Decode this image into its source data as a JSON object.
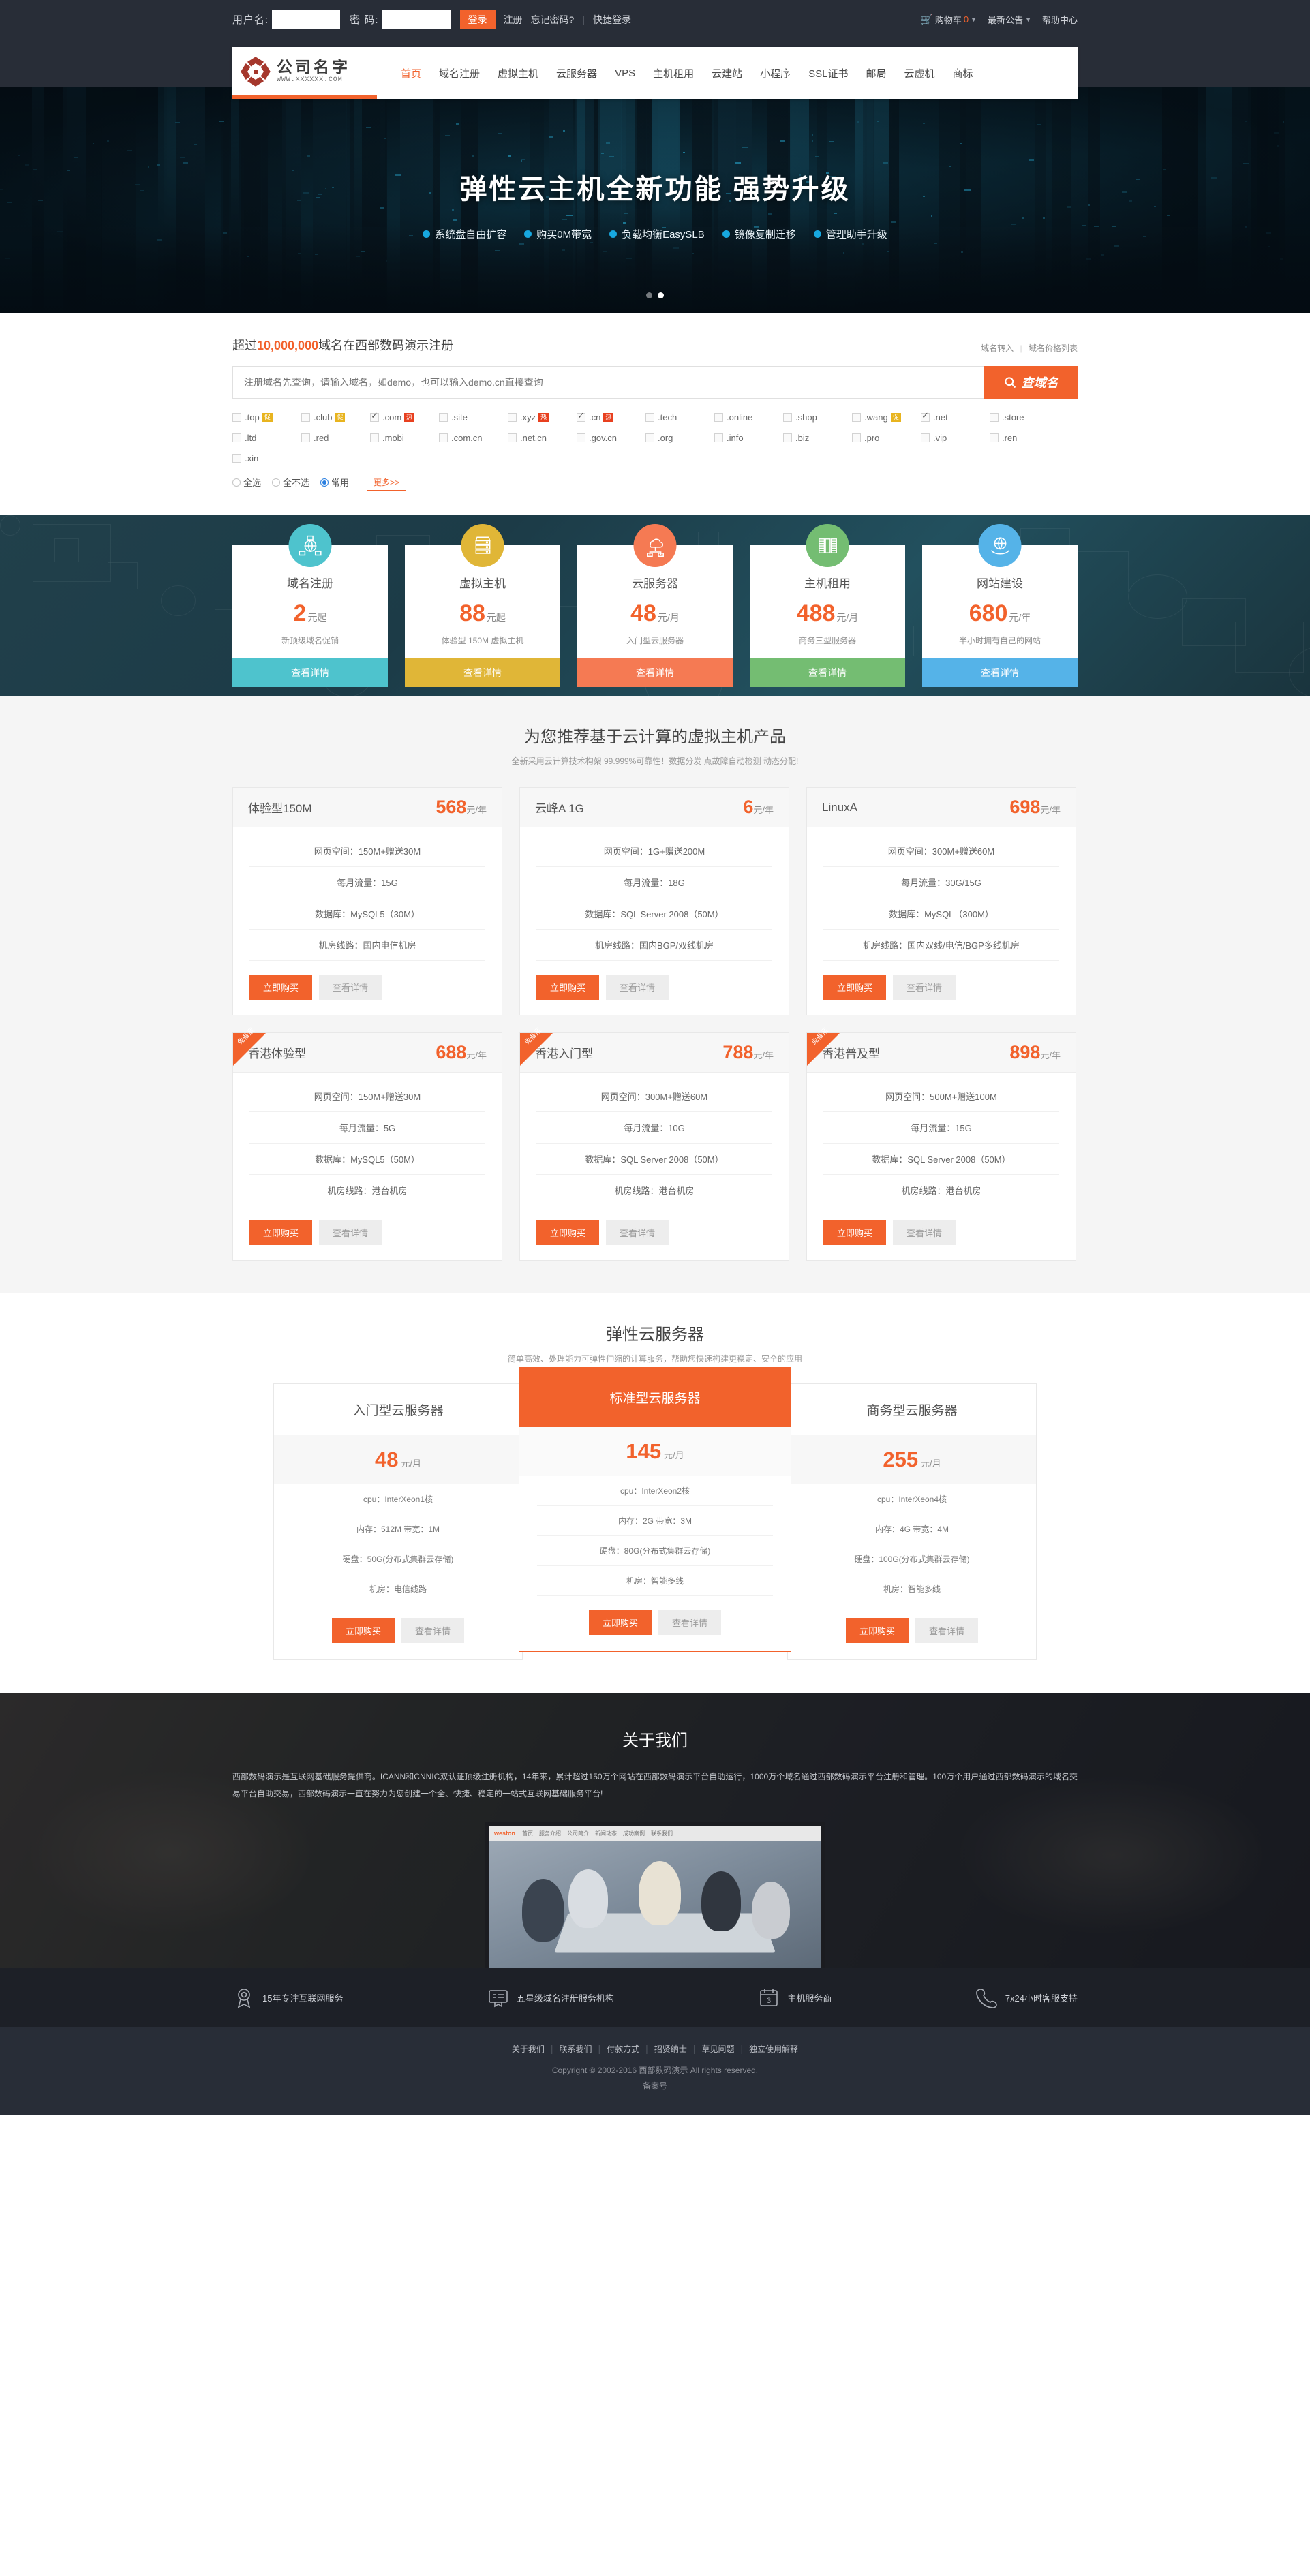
{
  "topbar": {
    "username_label": "用户名:",
    "username_value": "",
    "username_placeholder": "",
    "password_label": "密  码:",
    "password_value": "",
    "password_placeholder": "",
    "login_button": "登录",
    "register_link": "注册",
    "forgot_link": "忘记密码?",
    "quick_login": "快捷登录",
    "cart_label": "购物车",
    "cart_count": "0",
    "notice_label": "最新公告",
    "help_label": "帮助中心"
  },
  "header": {
    "logo_name": "公司名字",
    "logo_url": "WWW.XXXXXX.COM",
    "nav": [
      {
        "label": "首页",
        "active": true
      },
      {
        "label": "域名注册",
        "active": false
      },
      {
        "label": "虚拟主机",
        "active": false
      },
      {
        "label": "云服务器",
        "active": false
      },
      {
        "label": "VPS",
        "active": false
      },
      {
        "label": "主机租用",
        "active": false
      },
      {
        "label": "云建站",
        "active": false
      },
      {
        "label": "小程序",
        "active": false
      },
      {
        "label": "SSL证书",
        "active": false
      },
      {
        "label": "邮局",
        "active": false
      },
      {
        "label": "云虚机",
        "active": false
      },
      {
        "label": "商标",
        "active": false
      }
    ]
  },
  "hero": {
    "title": "弹性云主机全新功能  强势升级",
    "features": [
      "系统盘自由扩容",
      "购买0M带宽",
      "负载均衡EasySLB",
      "镜像复制迁移",
      "管理助手升级"
    ],
    "slides": 2,
    "active_slide": 1
  },
  "domain": {
    "title_pre": "超过",
    "title_num": "10,000,000",
    "title_post": "域名在西部数码演示注册",
    "link_transfer": "域名转入",
    "link_pricelist": "域名价格列表",
    "search_placeholder": "注册域名先查询，请输入域名，如demo，也可以输入demo.cn直接查询",
    "search_value": "",
    "search_button": "查域名",
    "tlds_row1": [
      {
        "name": ".top",
        "checked": false,
        "tag": "促",
        "tagtype": "cu"
      },
      {
        "name": ".club",
        "checked": false,
        "tag": "促",
        "tagtype": "cu"
      },
      {
        "name": ".com",
        "checked": true,
        "tag": "热",
        "tagtype": "hot"
      },
      {
        "name": ".site",
        "checked": false,
        "tag": "",
        "tagtype": ""
      },
      {
        "name": ".xyz",
        "checked": false,
        "tag": "热",
        "tagtype": "hot"
      },
      {
        "name": ".cn",
        "checked": true,
        "tag": "热",
        "tagtype": "hot"
      },
      {
        "name": ".tech",
        "checked": false,
        "tag": "",
        "tagtype": ""
      },
      {
        "name": ".online",
        "checked": false,
        "tag": "",
        "tagtype": ""
      },
      {
        "name": ".shop",
        "checked": false,
        "tag": "",
        "tagtype": ""
      },
      {
        "name": ".wang",
        "checked": false,
        "tag": "促",
        "tagtype": "cu"
      },
      {
        "name": ".net",
        "checked": true,
        "tag": "",
        "tagtype": ""
      },
      {
        "name": ".store",
        "checked": false,
        "tag": "",
        "tagtype": ""
      }
    ],
    "tlds_row2": [
      {
        "name": ".ltd",
        "checked": false,
        "tag": "",
        "tagtype": ""
      },
      {
        "name": ".red",
        "checked": false,
        "tag": "",
        "tagtype": ""
      },
      {
        "name": ".mobi",
        "checked": false,
        "tag": "",
        "tagtype": ""
      },
      {
        "name": ".com.cn",
        "checked": false,
        "tag": "",
        "tagtype": ""
      },
      {
        "name": ".net.cn",
        "checked": false,
        "tag": "",
        "tagtype": ""
      },
      {
        "name": ".gov.cn",
        "checked": false,
        "tag": "",
        "tagtype": ""
      },
      {
        "name": ".org",
        "checked": false,
        "tag": "",
        "tagtype": ""
      },
      {
        "name": ".info",
        "checked": false,
        "tag": "",
        "tagtype": ""
      },
      {
        "name": ".biz",
        "checked": false,
        "tag": "",
        "tagtype": ""
      },
      {
        "name": ".pro",
        "checked": false,
        "tag": "",
        "tagtype": ""
      },
      {
        "name": ".vip",
        "checked": false,
        "tag": "",
        "tagtype": ""
      },
      {
        "name": ".ren",
        "checked": false,
        "tag": "",
        "tagtype": ""
      }
    ],
    "tlds_row3": [
      {
        "name": ".xin",
        "checked": false,
        "tag": "",
        "tagtype": ""
      }
    ],
    "radios": [
      {
        "label": "全选",
        "checked": false
      },
      {
        "label": "全不选",
        "checked": false
      },
      {
        "label": "常用",
        "checked": true
      }
    ],
    "more_button": "更多>>"
  },
  "product_cards": [
    {
      "name": "域名注册",
      "price": "2",
      "unit": "元起",
      "desc": "新顶级域名促销",
      "cta": "查看详情",
      "color": "#4ec3cd",
      "icon": "network-icon"
    },
    {
      "name": "虚拟主机",
      "price": "88",
      "unit": "元起",
      "desc": "体验型 150M 虚拟主机",
      "cta": "查看详情",
      "color": "#e0b637",
      "icon": "server-icon"
    },
    {
      "name": "云服务器",
      "price": "48",
      "unit": "元/月",
      "desc": "入门型云服务器",
      "cta": "查看详情",
      "color": "#f57a53",
      "icon": "cloud-network-icon"
    },
    {
      "name": "主机租用",
      "price": "488",
      "unit": "元/月",
      "desc": "商务三型服务器",
      "cta": "查看详情",
      "color": "#74bd72",
      "icon": "rack-icon"
    },
    {
      "name": "网站建设",
      "price": "680",
      "unit": "元/年",
      "desc": "半小时拥有自己的网站",
      "cta": "查看详情",
      "color": "#55b3e8",
      "icon": "globe-hands-icon"
    }
  ],
  "hosting": {
    "title": "为您推荐基于云计算的虚拟主机产品",
    "subtitle": "全新采用云计算技术构架 99.999%可靠性！数据分发 点故障自动检测 动态分配!",
    "buy_label": "立即购买",
    "detail_label": "查看详情",
    "ribbon_label": "免备案",
    "plans": [
      {
        "name": "体验型150M",
        "price": "568",
        "unit": "元/年",
        "ribbon": false,
        "specs": [
          "网页空间：150M+赠送30M",
          "每月流量：15G",
          "数据库：MySQL5（30M）",
          "机房线路：国内电信机房"
        ]
      },
      {
        "name": "云峰A 1G",
        "price": "6",
        "unit": "元/年",
        "ribbon": false,
        "specs": [
          "网页空间：1G+赠送200M",
          "每月流量：18G",
          "数据库：SQL Server 2008（50M）",
          "机房线路：国内BGP/双线机房"
        ]
      },
      {
        "name": "LinuxA",
        "price": "698",
        "unit": "元/年",
        "ribbon": false,
        "specs": [
          "网页空间：300M+赠送60M",
          "每月流量：30G/15G",
          "数据库：MySQL（300M）",
          "机房线路：国内双线/电信/BGP多线机房"
        ]
      },
      {
        "name": "香港体验型",
        "price": "688",
        "unit": "元/年",
        "ribbon": true,
        "specs": [
          "网页空间：150M+赠送30M",
          "每月流量：5G",
          "数据库：MySQL5（50M）",
          "机房线路：港台机房"
        ]
      },
      {
        "name": "香港入门型",
        "price": "788",
        "unit": "元/年",
        "ribbon": true,
        "specs": [
          "网页空间：300M+赠送60M",
          "每月流量：10G",
          "数据库：SQL Server 2008（50M）",
          "机房线路：港台机房"
        ]
      },
      {
        "name": "香港普及型",
        "price": "898",
        "unit": "元/年",
        "ribbon": true,
        "specs": [
          "网页空间：500M+赠送100M",
          "每月流量：15G",
          "数据库：SQL Server 2008（50M）",
          "机房线路：港台机房"
        ]
      }
    ]
  },
  "cloud": {
    "title": "弹性云服务器",
    "subtitle": "简单高效、处理能力可弹性伸缩的计算服务，帮助您快速构建更稳定、安全的应用",
    "buy_label": "立即购买",
    "detail_label": "查看详情",
    "plans": [
      {
        "name": "入门型云服务器",
        "price": "48",
        "unit": "元/月",
        "featured": false,
        "specs": [
          "cpu：InterXeon1核",
          "内存：512M  带宽：1M",
          "硬盘：50G(分布式集群云存储)",
          "机房：电信线路"
        ]
      },
      {
        "name": "标准型云服务器",
        "price": "145",
        "unit": "元/月",
        "featured": true,
        "specs": [
          "cpu：InterXeon2核",
          "内存：2G  带宽：3M",
          "硬盘：80G(分布式集群云存储)",
          "机房：智能多线"
        ]
      },
      {
        "name": "商务型云服务器",
        "price": "255",
        "unit": "元/月",
        "featured": false,
        "specs": [
          "cpu：InterXeon4核",
          "内存：4G  带宽：4M",
          "硬盘：100G(分布式集群云存储)",
          "机房：智能多线"
        ]
      }
    ]
  },
  "about": {
    "title": "关于我们",
    "paragraph": "西部数码演示是互联网基础服务提供商。ICANN和CNNIC双认证顶级注册机构，14年来，累计超过150万个网站在西部数码演示平台自助运行，1000万个域名通过西部数码演示平台注册和管理。100万个用户通过西部数码演示的域名交易平台自助交易，西部数码演示一直在努力为您创建一个全、快捷、稳定的一站式互联网基础服务平台!",
    "photo_logo": "weston"
  },
  "features": [
    {
      "label": "15年专注互联网服务",
      "icon": "medal-icon"
    },
    {
      "label": "五星级域名注册服务机构",
      "icon": "certificate-icon"
    },
    {
      "label": "主机服务商",
      "icon": "calendar-icon"
    },
    {
      "label": "7x24小时客服支持",
      "icon": "phone-icon"
    }
  ],
  "footer": {
    "links": [
      "关于我们",
      "联系我们",
      "付款方式",
      "招贤纳士",
      "草见问题",
      "独立使用解释"
    ],
    "copyright": "Copyright © 2002-2016 西部数码演示 All rights reserved.",
    "icp": "备案号"
  }
}
